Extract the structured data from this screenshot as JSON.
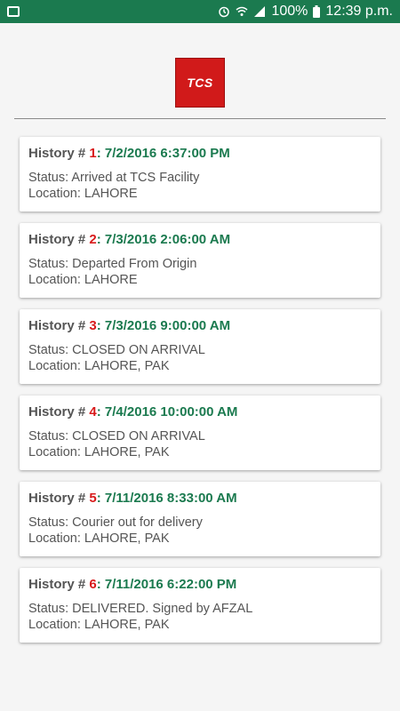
{
  "status_bar": {
    "battery": "100%",
    "time": "12:39 p.m."
  },
  "app": {
    "logo_text": "TCS"
  },
  "history": [
    {
      "label": "History # ",
      "number": "1",
      "date": ": 7/2/2016 6:37:00 PM",
      "status": "Status: Arrived at TCS Facility",
      "location": "Location: LAHORE"
    },
    {
      "label": "History # ",
      "number": "2",
      "date": ": 7/3/2016 2:06:00 AM",
      "status": "Status: Departed From Origin",
      "location": "Location: LAHORE"
    },
    {
      "label": "History # ",
      "number": "3",
      "date": ": 7/3/2016 9:00:00 AM",
      "status": "Status: CLOSED ON ARRIVAL",
      "location": "Location: LAHORE, PAK"
    },
    {
      "label": "History # ",
      "number": "4",
      "date": ": 7/4/2016 10:00:00 AM",
      "status": "Status: CLOSED ON ARRIVAL",
      "location": "Location: LAHORE, PAK"
    },
    {
      "label": "History # ",
      "number": "5",
      "date": ": 7/11/2016 8:33:00 AM",
      "status": "Status: Courier out for delivery",
      "location": "Location: LAHORE, PAK"
    },
    {
      "label": "History # ",
      "number": "6",
      "date": ": 7/11/2016 6:22:00 PM",
      "status": "Status: DELIVERED. Signed by AFZAL",
      "location": "Location: LAHORE, PAK"
    }
  ]
}
